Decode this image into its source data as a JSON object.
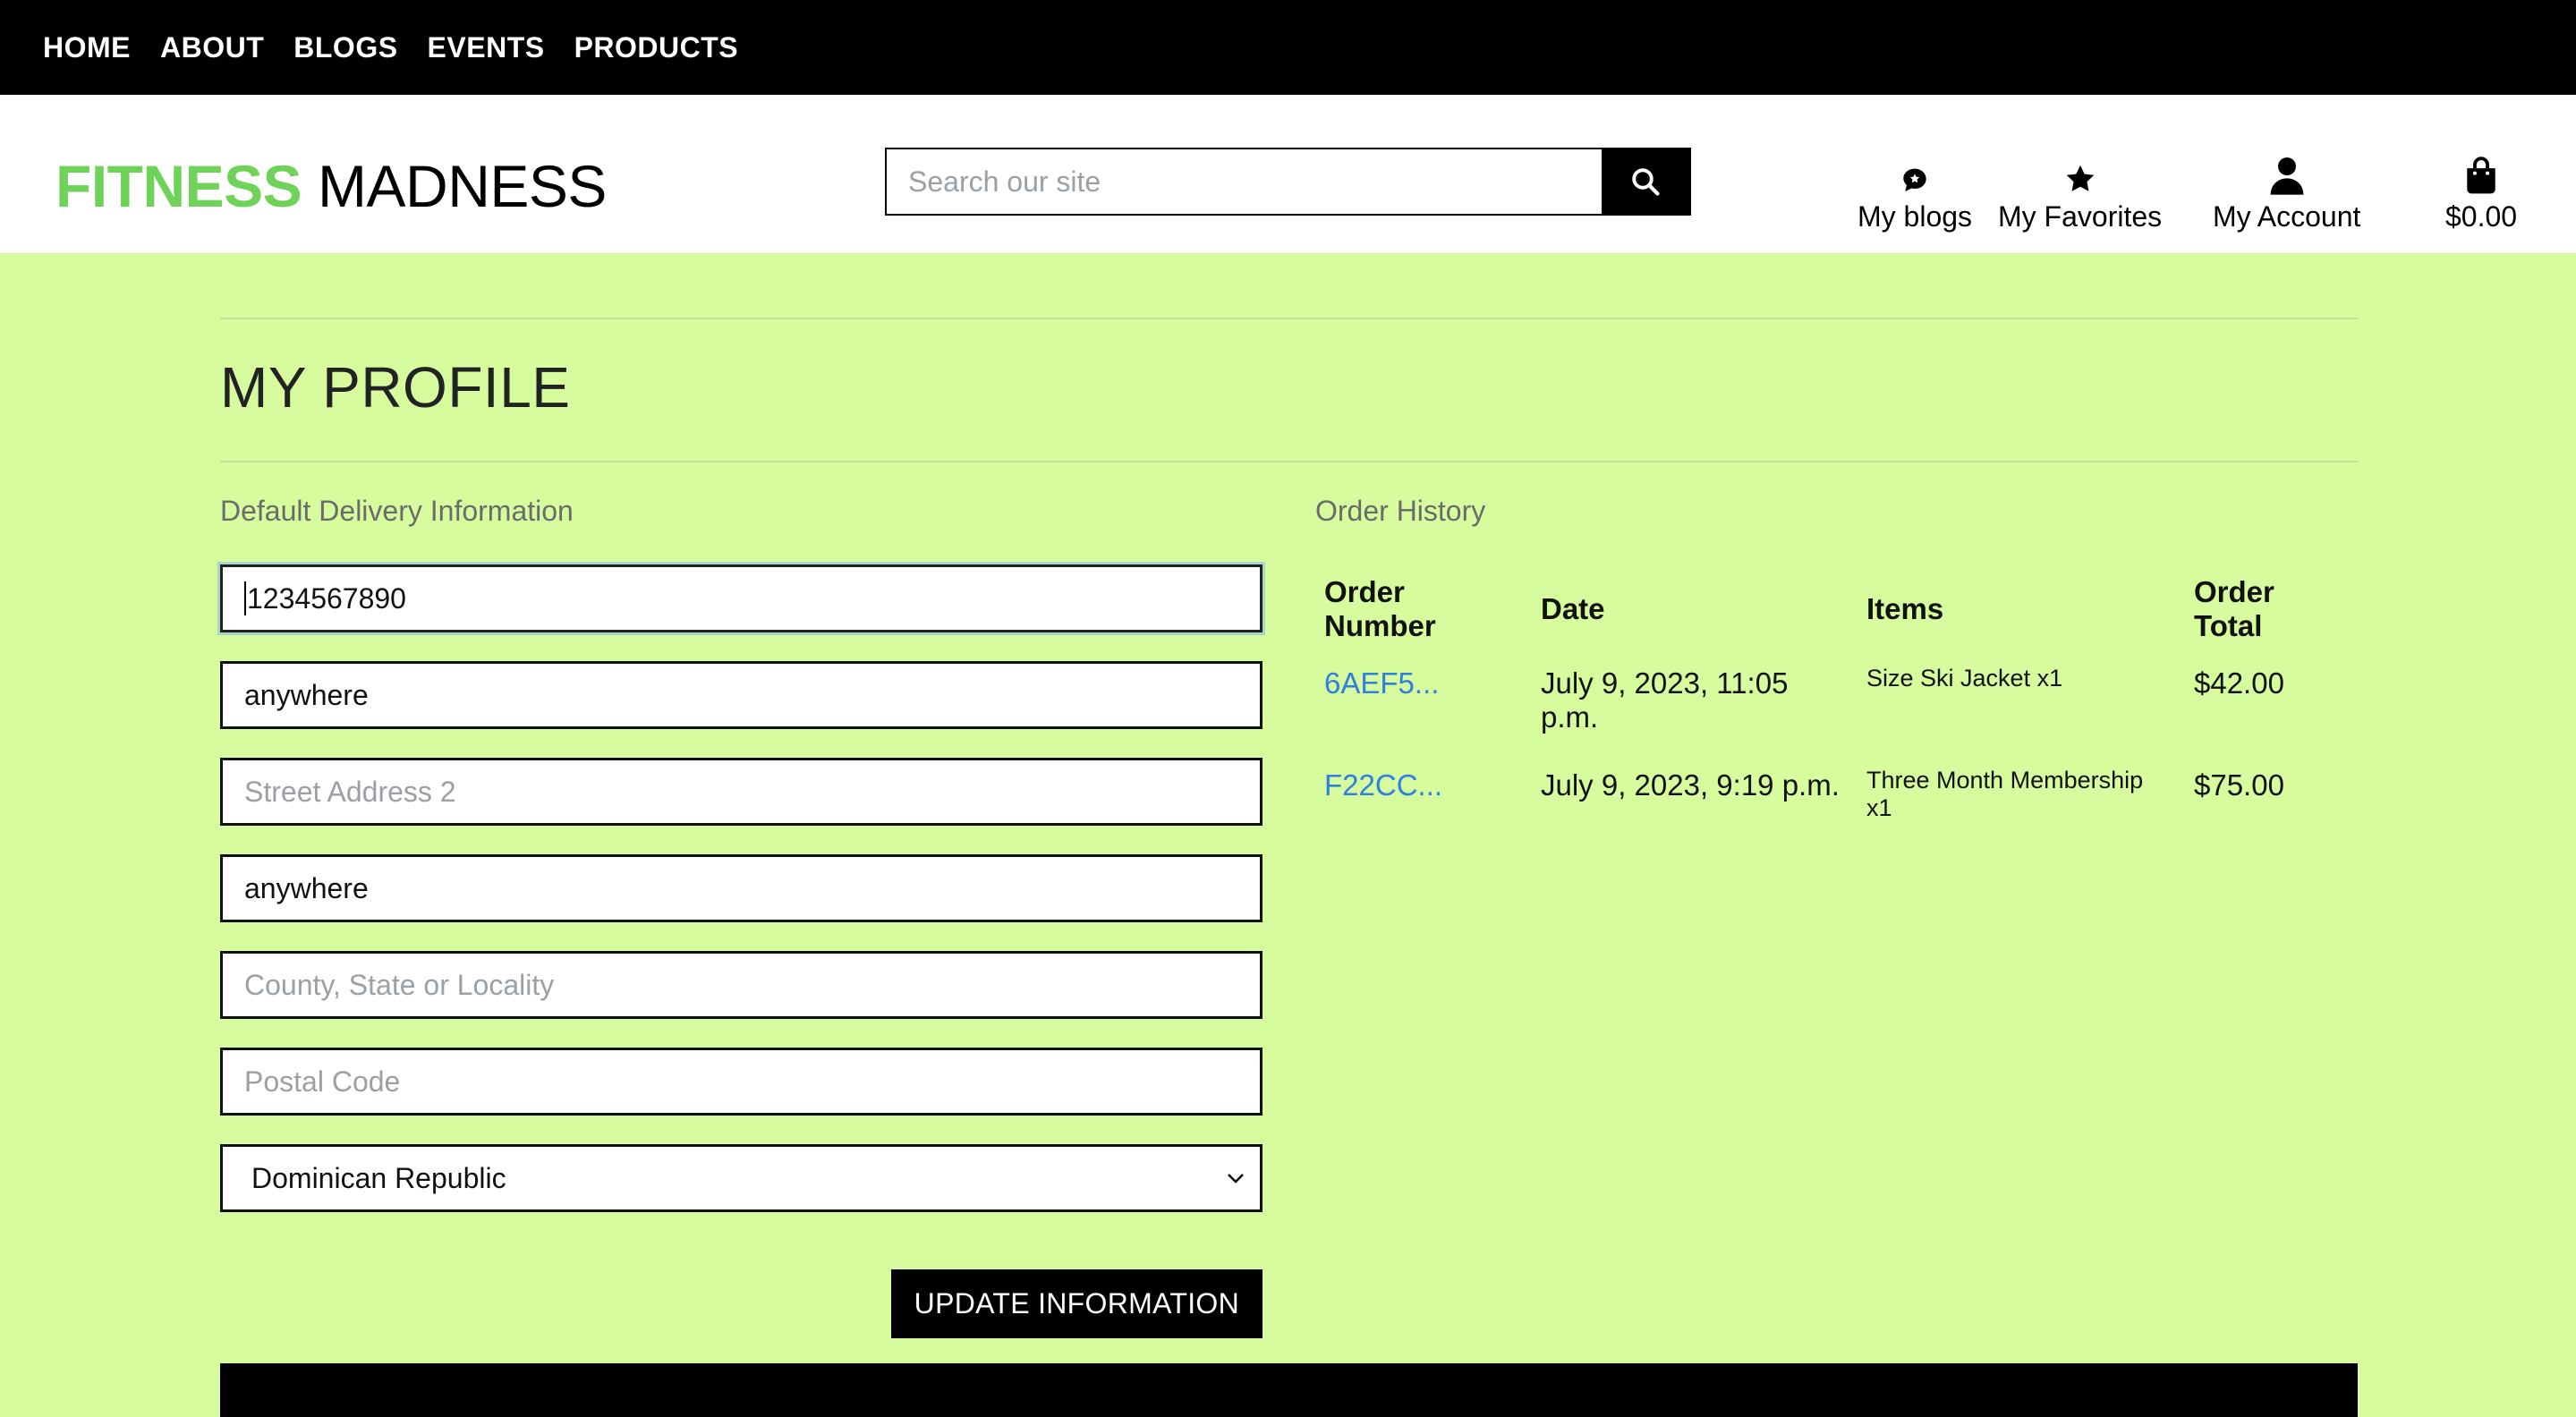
{
  "topnav": {
    "items": [
      "HOME",
      "ABOUT",
      "BLOGS",
      "EVENTS",
      "PRODUCTS"
    ]
  },
  "header": {
    "logo_part1": "FITNESS",
    "logo_part2": "MADNESS",
    "search_placeholder": "Search our site",
    "links": {
      "blogs": "My blogs",
      "favorites": "My Favorites",
      "account": "My Account",
      "cart": "$0.00"
    }
  },
  "colors": {
    "page_bg": "#d6fc9e",
    "brand_green": "#6fd35a",
    "link_blue": "#2e7fe0"
  },
  "profile": {
    "title": "MY PROFILE",
    "delivery_label": "Default Delivery Information",
    "fields": {
      "phone": "1234567890",
      "street1": "anywhere",
      "street2_placeholder": "Street Address 2",
      "town": "anywhere",
      "county_placeholder": "County, State or Locality",
      "postcode_placeholder": "Postal Code",
      "country": "Dominican Republic"
    },
    "update_button": "UPDATE INFORMATION"
  },
  "orders": {
    "label": "Order History",
    "headers": [
      "Order Number",
      "Date",
      "Items",
      "Order Total"
    ],
    "rows": [
      {
        "number": "6AEF5...",
        "date": "July 9, 2023, 11:05 p.m.",
        "items": "Size Ski Jacket x1",
        "total": "$42.00"
      },
      {
        "number": "F22CC...",
        "date": "July 9, 2023, 9:19 p.m.",
        "items": "Three Month Membership x1",
        "total": "$75.00"
      }
    ]
  }
}
